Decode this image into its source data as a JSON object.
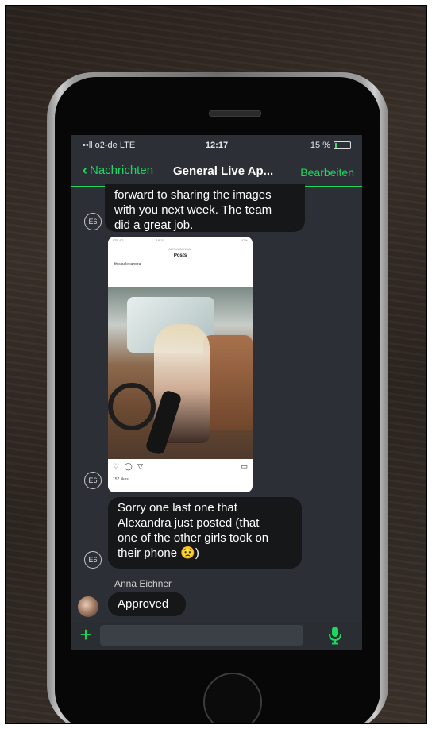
{
  "status": {
    "carrier": "••ll o2-de  LTE",
    "time": "12:17",
    "battery": "15 %"
  },
  "nav": {
    "back_label": "Nachrichten",
    "title": "General Live Ap...",
    "edit_label": "Bearbeiten"
  },
  "messages": {
    "first": {
      "badge": "E6",
      "lines": [
        "forward to sharing the images",
        "with you next week. The team",
        "did a great job."
      ]
    },
    "image": {
      "badge": "E6",
      "mini_status_left": "LTE  4G",
      "mini_status_time": "18:19",
      "mini_status_right": "47%",
      "mini_title": "Posts",
      "mini_subtitle": "ALEXA BANSAL",
      "mini_user": "thisisalexandra",
      "mini_likes": "157 likes"
    },
    "second": {
      "badge": "E6",
      "lines": [
        "Sorry one last one that",
        "Alexandra just posted (that",
        "one of the other girls took on",
        "their phone 😟)"
      ]
    },
    "third": {
      "sender": "Anna Eichner",
      "text": "Approved"
    }
  },
  "input": {
    "placeholder": ""
  },
  "colors": {
    "accent": "#1ed760",
    "bubble": "#151719",
    "screen_bg": "#2c3036"
  },
  "icons": {
    "back": "chevron-left-icon",
    "attach": "plus-icon",
    "voice": "microphone-icon"
  }
}
